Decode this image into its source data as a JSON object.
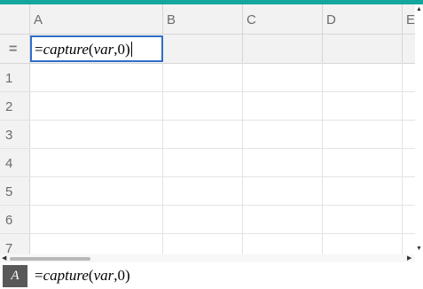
{
  "columns": [
    "A",
    "B",
    "C",
    "D",
    "E"
  ],
  "formula_row": {
    "icon": "=",
    "prefix": "=",
    "func": "capture",
    "paren_open": "(",
    "arg1": "var",
    "sep": ",",
    "arg2": "0",
    "paren_close": ")"
  },
  "rows": [
    "1",
    "2",
    "3",
    "4",
    "5",
    "6",
    "7"
  ],
  "status": {
    "cell_ref": "A",
    "prefix": "=",
    "func": "capture",
    "paren_open": "(",
    "arg1": "var",
    "sep": ",",
    "arg2": "0",
    "paren_close": ")"
  },
  "colors": {
    "accent": "#14a79d",
    "selection": "#2f6ec7"
  },
  "icons": {
    "scroll_up": "triangle-up-icon",
    "scroll_down": "triangle-down-icon",
    "scroll_left": "triangle-left-icon",
    "scroll_right": "triangle-right-icon"
  }
}
